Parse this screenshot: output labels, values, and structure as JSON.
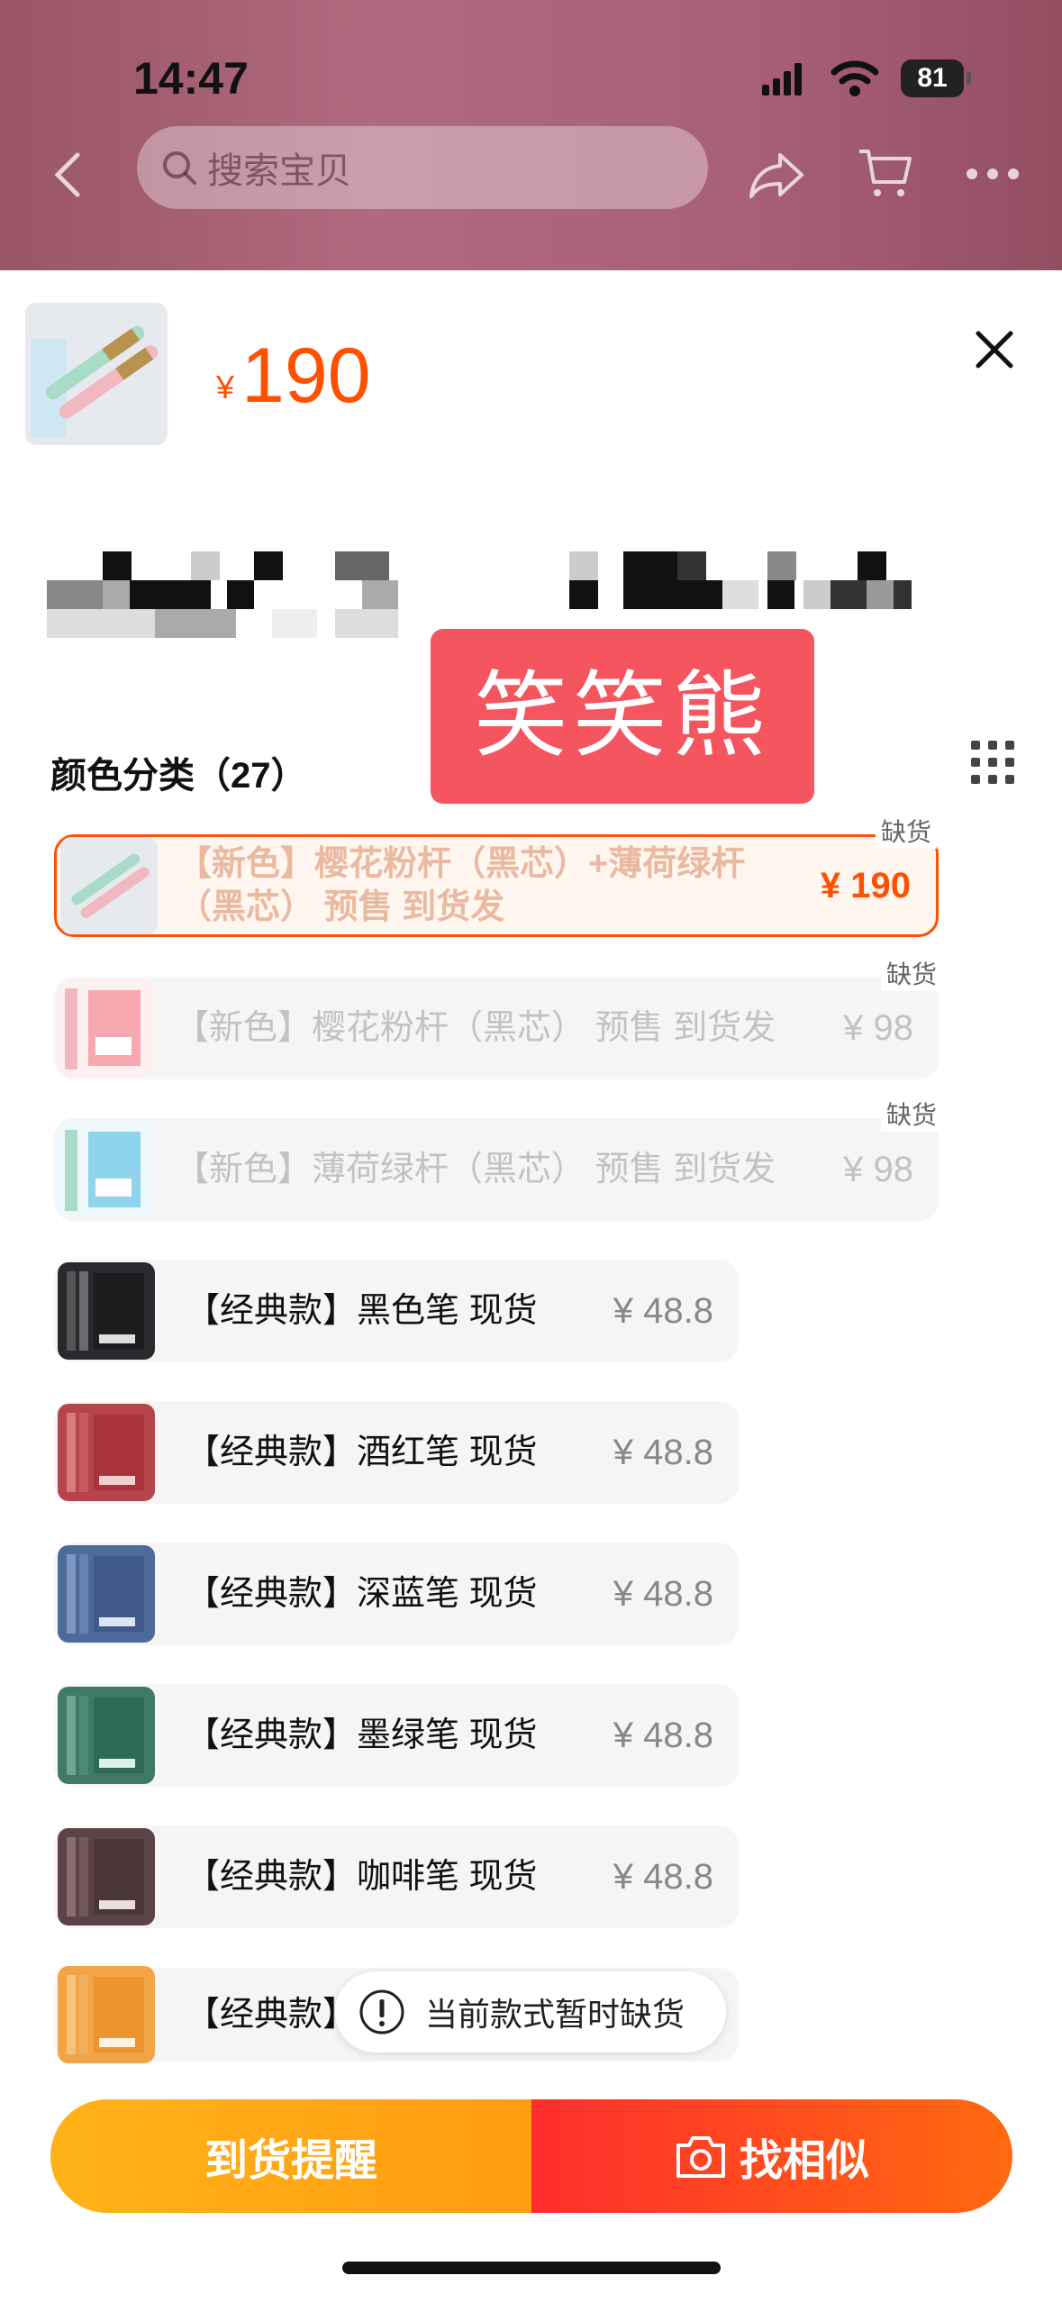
{
  "status_bar": {
    "time": "14:47",
    "battery": "81"
  },
  "nav": {
    "search_placeholder": "搜索宝贝"
  },
  "product": {
    "currency": "¥",
    "price": "190"
  },
  "watermark": "笑笑熊",
  "section": {
    "title": "颜色分类（27）"
  },
  "options": [
    {
      "label": "【新色】樱花粉杆（黑芯）+薄荷绿杆（黑芯） 预售 到货发",
      "price": "¥ 190",
      "tag": "缺货",
      "state": "selected-out-of-stock"
    },
    {
      "label": "【新色】樱花粉杆（黑芯） 预售 到货发",
      "price": "¥ 98",
      "tag": "缺货",
      "state": "out-of-stock"
    },
    {
      "label": "【新色】薄荷绿杆（黑芯） 预售 到货发",
      "price": "¥ 98",
      "tag": "缺货",
      "state": "out-of-stock"
    },
    {
      "label": "【经典款】黑色笔 现货",
      "price": "¥ 48.8",
      "state": "available"
    },
    {
      "label": "【经典款】酒红笔 现货",
      "price": "¥ 48.8",
      "state": "available"
    },
    {
      "label": "【经典款】深蓝笔 现货",
      "price": "¥ 48.8",
      "state": "available"
    },
    {
      "label": "【经典款】墨绿笔 现货",
      "price": "¥ 48.8",
      "state": "available"
    },
    {
      "label": "【经典款】咖啡笔 现货",
      "price": "¥ 48.8",
      "state": "available"
    },
    {
      "label": "【经典款】",
      "state": "available"
    }
  ],
  "toast": "当前款式暂时缺货",
  "actions": {
    "notify": "到货提醒",
    "find_similar": "找相似"
  },
  "colors": {
    "accent": "#ff5000",
    "notify_btn": "#ffb318",
    "similar_btn": "#ff2d2d",
    "watermark_bg": "#f4555f"
  },
  "icons": [
    "back-icon",
    "search-icon",
    "share-icon",
    "cart-icon",
    "more-icon",
    "close-icon",
    "grid-icon",
    "alert-icon",
    "camera-icon"
  ]
}
